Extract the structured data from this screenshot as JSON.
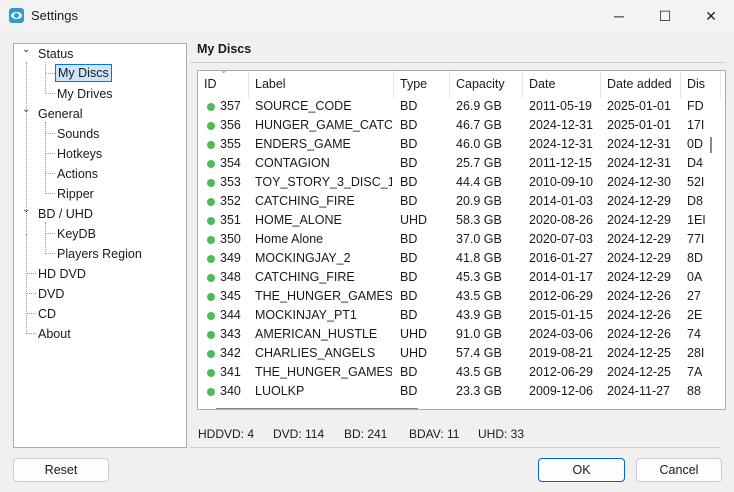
{
  "window": {
    "title": "Settings",
    "minimize": "─",
    "maximize": "☐",
    "close": "✕"
  },
  "tree": {
    "status": "Status",
    "my_discs": "My Discs",
    "my_drives": "My Drives",
    "general": "General",
    "sounds": "Sounds",
    "hotkeys": "Hotkeys",
    "actions": "Actions",
    "ripper": "Ripper",
    "bd_uhd": "BD / UHD",
    "keydb": "KeyDB",
    "players_region": "Players Region",
    "hd_dvd": "HD DVD",
    "dvd": "DVD",
    "cd": "CD",
    "about": "About",
    "chevron": "⌄"
  },
  "main": {
    "title": "My Discs"
  },
  "table": {
    "sort_indicator": "⌄",
    "columns": [
      "ID",
      "Label",
      "Type",
      "Capacity",
      "Date",
      "Date added",
      "Dis"
    ],
    "status_color": "#4cbb5a",
    "rows": [
      [
        "357",
        "SOURCE_CODE",
        "BD",
        "26.9 GB",
        "2011-05-19",
        "2025-01-01",
        "FD"
      ],
      [
        "356",
        "HUNGER_GAME_CATC...",
        "BD",
        "46.7 GB",
        "2024-12-31",
        "2025-01-01",
        "17I"
      ],
      [
        "355",
        "ENDERS_GAME",
        "BD",
        "46.0 GB",
        "2024-12-31",
        "2024-12-31",
        "0D"
      ],
      [
        "354",
        "CONTAGION",
        "BD",
        "25.7 GB",
        "2011-12-15",
        "2024-12-31",
        "D4"
      ],
      [
        "353",
        "TOY_STORY_3_DISC_1",
        "BD",
        "44.4 GB",
        "2010-09-10",
        "2024-12-30",
        "52I"
      ],
      [
        "352",
        "CATCHING_FIRE",
        "BD",
        "20.9 GB",
        "2014-01-03",
        "2024-12-29",
        "D8"
      ],
      [
        "351",
        "HOME_ALONE",
        "UHD",
        "58.3 GB",
        "2020-08-26",
        "2024-12-29",
        "1EI"
      ],
      [
        "350",
        "Home Alone",
        "BD",
        "37.0 GB",
        "2020-07-03",
        "2024-12-29",
        "77I"
      ],
      [
        "349",
        "MOCKINGJAY_2",
        "BD",
        "41.8 GB",
        "2016-01-27",
        "2024-12-29",
        "8D"
      ],
      [
        "348",
        "CATCHING_FIRE",
        "BD",
        "45.3 GB",
        "2014-01-17",
        "2024-12-29",
        "0A"
      ],
      [
        "345",
        "THE_HUNGER_GAMES",
        "BD",
        "43.5 GB",
        "2012-06-29",
        "2024-12-26",
        "27"
      ],
      [
        "344",
        "MOCKINJAY_PT1",
        "BD",
        "43.9 GB",
        "2015-01-15",
        "2024-12-26",
        "2E"
      ],
      [
        "343",
        "AMERICAN_HUSTLE",
        "UHD",
        "91.0 GB",
        "2024-03-06",
        "2024-12-26",
        "74"
      ],
      [
        "342",
        "CHARLIES_ANGELS",
        "UHD",
        "57.4 GB",
        "2019-08-21",
        "2024-12-25",
        "28I"
      ],
      [
        "341",
        "THE_HUNGER_GAMES",
        "BD",
        "43.5 GB",
        "2012-06-29",
        "2024-12-25",
        "7A"
      ],
      [
        "340",
        "LUOLKP",
        "BD",
        "23.3 GB",
        "2009-12-06",
        "2024-11-27",
        "88"
      ]
    ]
  },
  "stats": {
    "hddvd": "HDDVD: 4",
    "dvd": "DVD: 114",
    "bd": "BD: 241",
    "bdav": "BDAV: 11",
    "uhd": "UHD: 33"
  },
  "buttons": {
    "reset": "Reset",
    "ok": "OK",
    "cancel": "Cancel"
  }
}
